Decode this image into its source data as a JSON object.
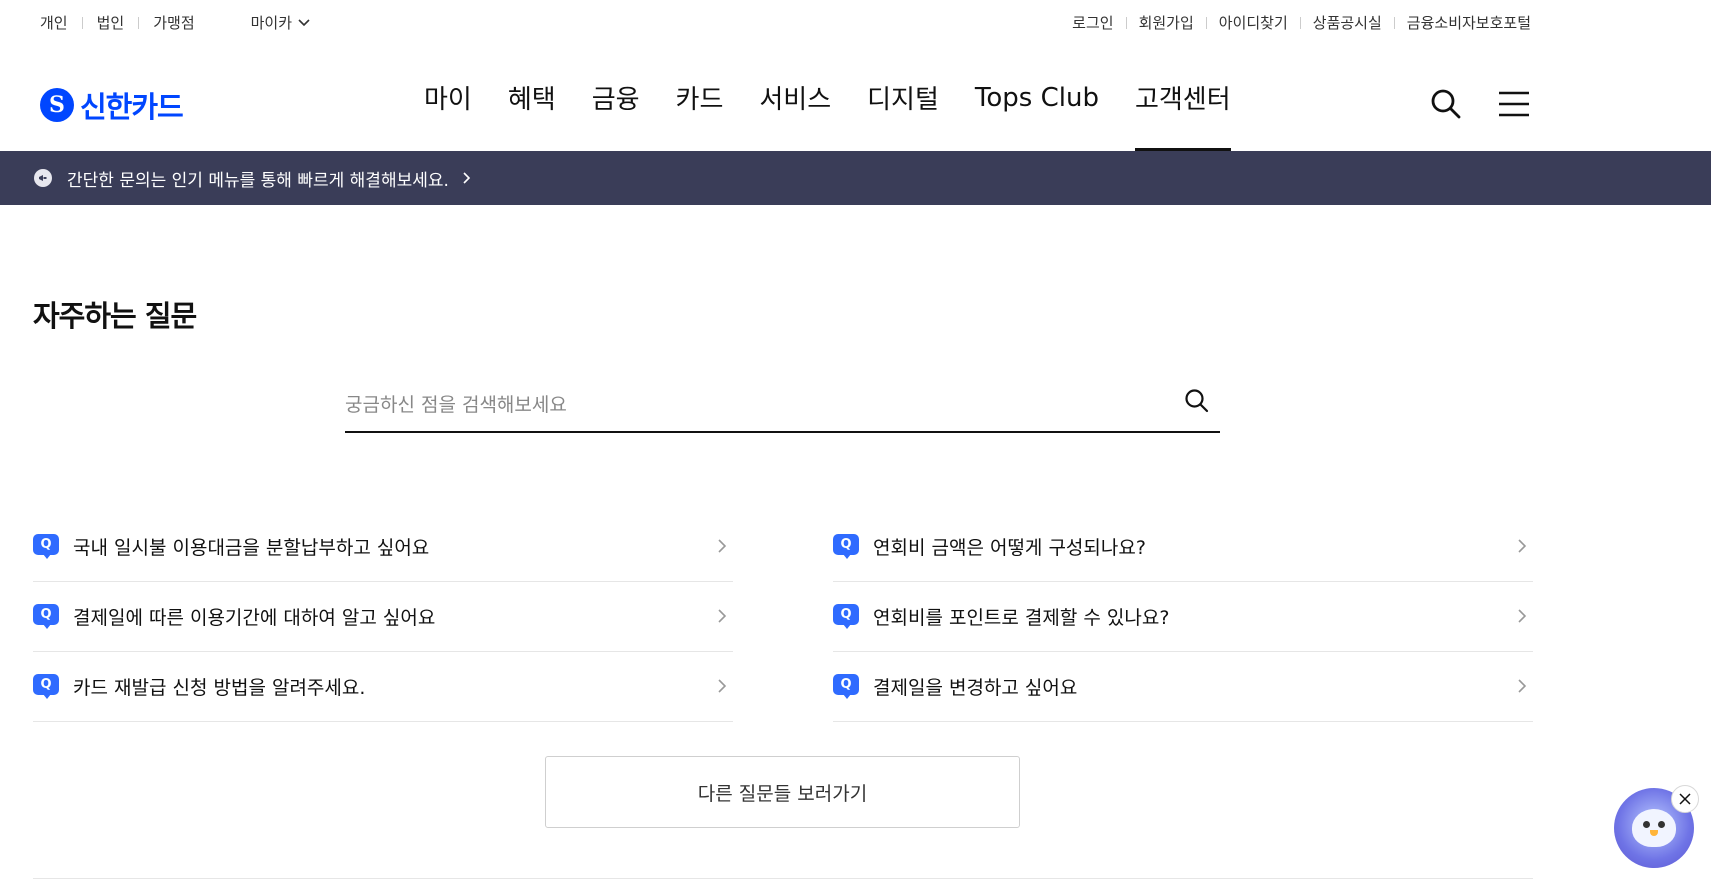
{
  "utility": {
    "left": [
      "개인",
      "법인",
      "가맹점"
    ],
    "my_card": "마이카",
    "right": [
      "로그인",
      "회원가입",
      "아이디찾기",
      "상품공시실",
      "금융소비자보호포털"
    ]
  },
  "logo": {
    "mark": "S",
    "text": "신한카드"
  },
  "gnb": {
    "menu": [
      "마이",
      "혜택",
      "금융",
      "카드",
      "서비스",
      "디지털",
      "Tops Club",
      "고객센터"
    ],
    "active_index": 7
  },
  "notice": {
    "text": "간단한 문의는 인기 메뉴를 통해 빠르게 해결해보세요."
  },
  "title": "자주하는 질문",
  "search": {
    "placeholder": "궁금하신 점을 검색해보세요"
  },
  "faq": {
    "badge": "Q",
    "left": [
      "국내 일시불 이용대금을 분할납부하고 싶어요",
      "결제일에 따른 이용기간에 대하여 알고 싶어요",
      "카드 재발급 신청 방법을 알려주세요."
    ],
    "right": [
      "연회비 금액은 어떻게 구성되나요?",
      "연회비를 포인트로 결제할 수 있나요?",
      "결제일을 변경하고 싶어요"
    ]
  },
  "more_button": "다른 질문들 보러가기",
  "colors": {
    "brand": "#0046ff",
    "notice_bg": "#3a3d58",
    "badge": "#2f6bff"
  }
}
